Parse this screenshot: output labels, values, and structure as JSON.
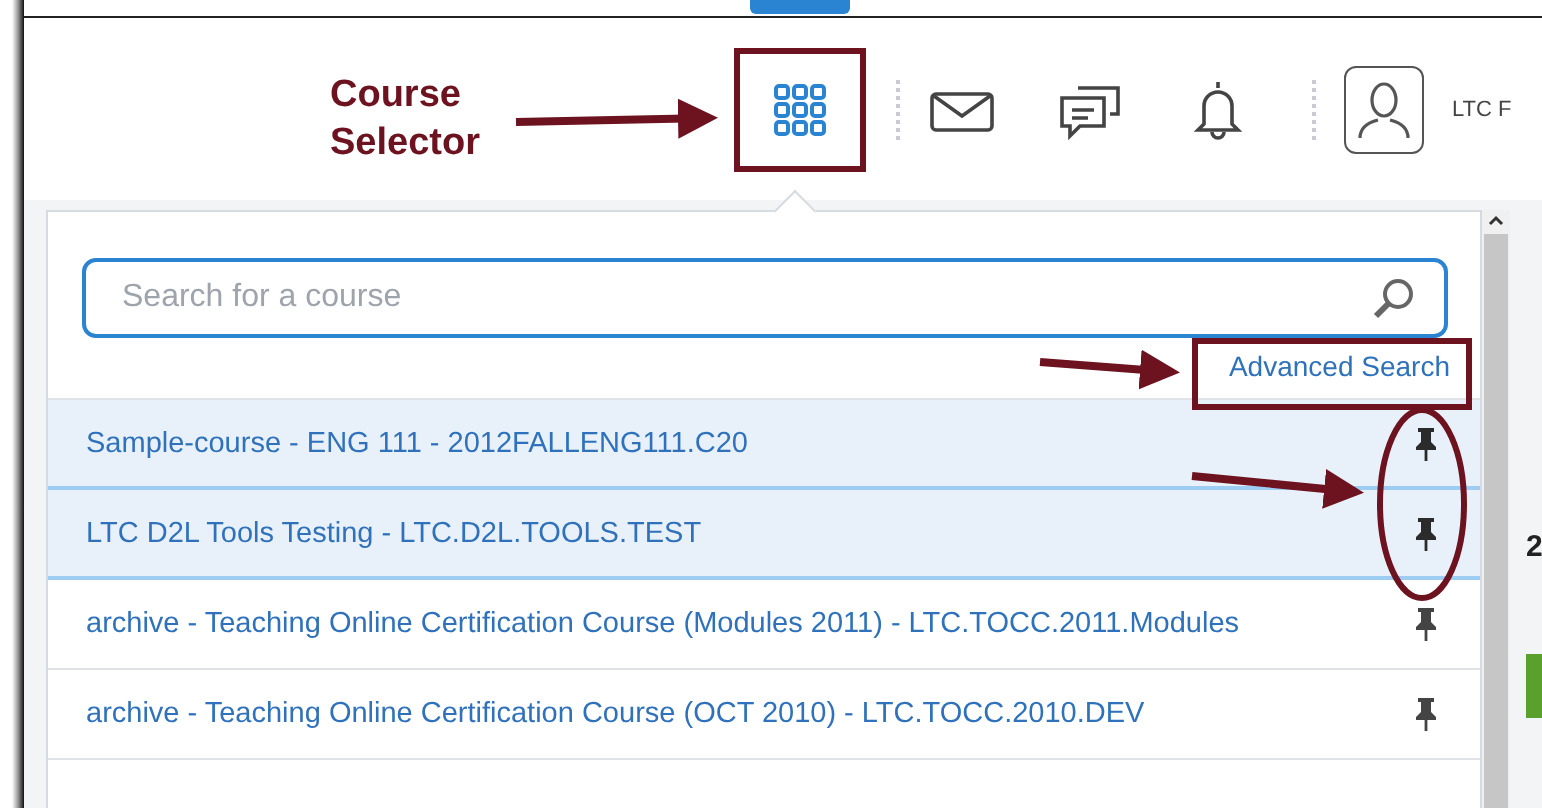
{
  "header": {
    "user_name": "LTC F"
  },
  "course_selector": {
    "search": {
      "placeholder": "Search for a course"
    },
    "advanced_search": "Advanced Search",
    "courses": [
      {
        "name": "Sample-course - ENG 111 - 2012FALLENG111.C20",
        "pinned": true
      },
      {
        "name": "LTC D2L Tools Testing - LTC.D2L.TOOLS.TEST",
        "pinned": true
      },
      {
        "name": "archive - Teaching Online Certification Course (Modules 2011) - LTC.TOCC.2011.Modules",
        "pinned": false
      },
      {
        "name": "archive - Teaching Online Certification Course (OCT 2010) - LTC.TOCC.2010.DEV",
        "pinned": false
      }
    ]
  },
  "background": {
    "partial_text": "2"
  },
  "callout": {
    "label": "Course Selector"
  }
}
